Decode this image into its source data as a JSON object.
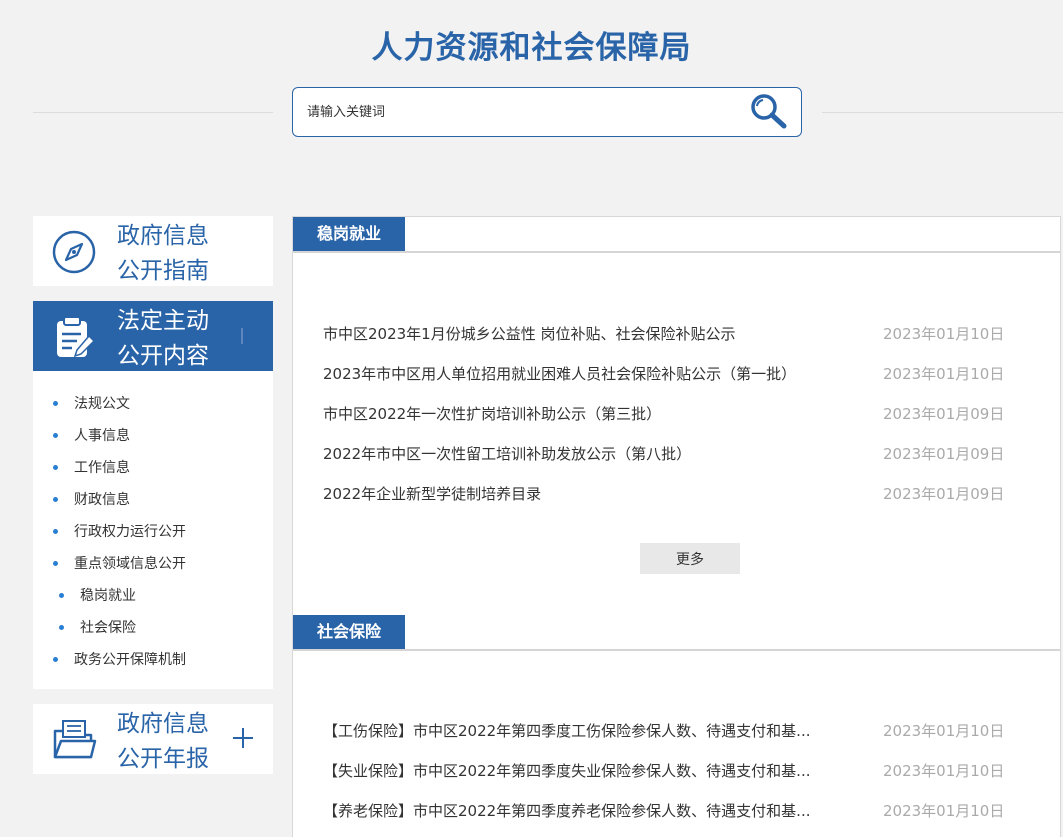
{
  "header": {
    "site_title": "人力资源和社会保障局",
    "search_placeholder": "请输入关键词"
  },
  "sidebar": {
    "guide_title_line1": "政府信息",
    "guide_title_line2": "公开指南",
    "active_title_line1": "法定主动",
    "active_title_line2": "公开内容",
    "report_title_line1": "政府信息",
    "report_title_line2": "公开年报",
    "items": [
      {
        "label": "法规公文"
      },
      {
        "label": "人事信息"
      },
      {
        "label": "工作信息"
      },
      {
        "label": "财政信息"
      },
      {
        "label": "行政权力运行公开"
      },
      {
        "label": "重点领域信息公开"
      },
      {
        "label": "稳岗就业"
      },
      {
        "label": "社会保险"
      },
      {
        "label": "政务公开保障机制"
      }
    ]
  },
  "sections": [
    {
      "title": "稳岗就业",
      "more_label": "更多",
      "items": [
        {
          "title": "市中区2023年1月份城乡公益性 岗位补贴、社会保险补贴公示",
          "date": "2023年01月10日"
        },
        {
          "title": "2023年市中区用人单位招用就业困难人员社会保险补贴公示（第一批）",
          "date": "2023年01月10日"
        },
        {
          "title": "市中区2022年一次性扩岗培训补助公示（第三批）",
          "date": "2023年01月09日"
        },
        {
          "title": "2022年市中区一次性留工培训补助发放公示（第八批）",
          "date": "2023年01月09日"
        },
        {
          "title": "2022年企业新型学徒制培养目录",
          "date": "2023年01月09日"
        }
      ]
    },
    {
      "title": "社会保险",
      "items": [
        {
          "title": "【工伤保险】市中区2022年第四季度工伤保险参保人数、待遇支付和基...",
          "date": "2023年01月10日"
        },
        {
          "title": "【失业保险】市中区2022年第四季度失业保险参保人数、待遇支付和基...",
          "date": "2023年01月10日"
        },
        {
          "title": "【养老保险】市中区2022年第四季度养老保险参保人数、待遇支付和基...",
          "date": "2023年01月10日"
        }
      ]
    }
  ],
  "colors": {
    "brand": "#2a64a8",
    "bullet": "#2a7fd4",
    "date": "#aaaaaa",
    "background": "#f2f2f2"
  },
  "icons": {
    "search": "search-icon",
    "guide": "compass-icon",
    "active": "clipboard-icon",
    "report": "folder-icon",
    "expand": "plus-icon"
  }
}
